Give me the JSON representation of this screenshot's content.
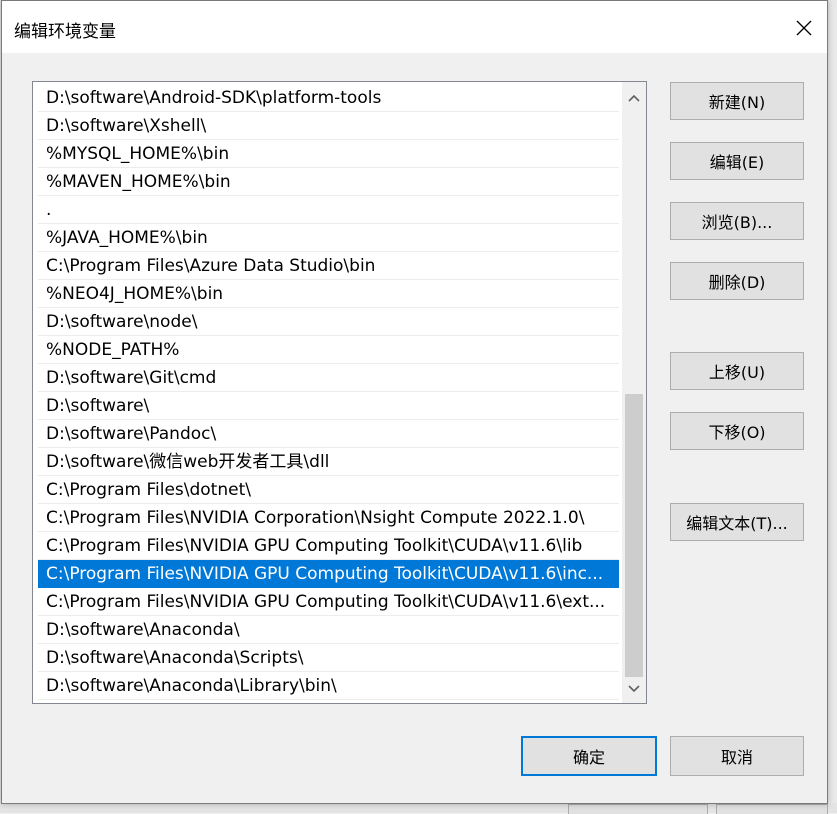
{
  "dialog": {
    "title": "编辑环境变量"
  },
  "path_entries": [
    "D:\\software\\Android-SDK\\platform-tools",
    "D:\\software\\Xshell\\",
    "%MYSQL_HOME%\\bin",
    "%MAVEN_HOME%\\bin",
    ".",
    "%JAVA_HOME%\\bin",
    "C:\\Program Files\\Azure Data Studio\\bin",
    "%NEO4J_HOME%\\bin",
    "D:\\software\\node\\",
    "%NODE_PATH%",
    "D:\\software\\Git\\cmd",
    "D:\\software\\",
    "D:\\software\\Pandoc\\",
    "D:\\software\\微信web开发者工具\\dll",
    "C:\\Program Files\\dotnet\\",
    "C:\\Program Files\\NVIDIA Corporation\\Nsight Compute 2022.1.0\\",
    "C:\\Program Files\\NVIDIA GPU Computing Toolkit\\CUDA\\v11.6\\lib",
    "C:\\Program Files\\NVIDIA GPU Computing Toolkit\\CUDA\\v11.6\\inc...",
    "C:\\Program Files\\NVIDIA GPU Computing Toolkit\\CUDA\\v11.6\\ext...",
    "D:\\software\\Anaconda\\",
    "D:\\software\\Anaconda\\Scripts\\",
    "D:\\software\\Anaconda\\Library\\bin\\"
  ],
  "selected_index": 17,
  "buttons": {
    "new": "新建(N)",
    "edit": "编辑(E)",
    "browse": "浏览(B)...",
    "delete": "删除(D)",
    "move_up": "上移(U)",
    "move_down": "下移(O)",
    "edit_text": "编辑文本(T)...",
    "ok": "确定",
    "cancel": "取消"
  },
  "colors": {
    "selection": "#0078d7",
    "primary_border": "#0078d7"
  },
  "icons": {
    "close": "close-icon",
    "scroll_up": "chevron-up-icon",
    "scroll_down": "chevron-down-icon"
  }
}
